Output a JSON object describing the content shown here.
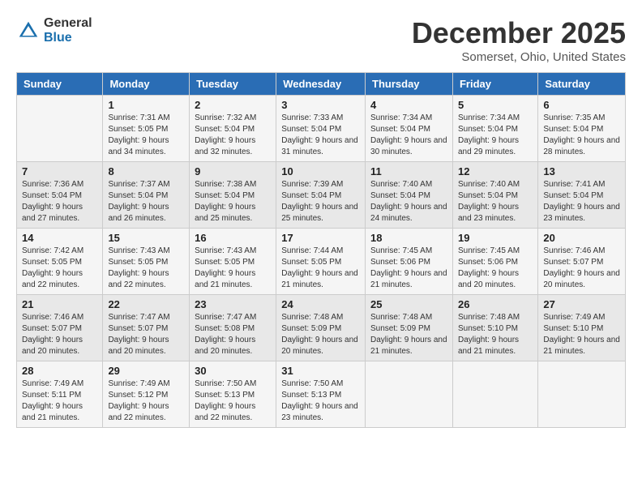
{
  "header": {
    "logo_general": "General",
    "logo_blue": "Blue",
    "month_title": "December 2025",
    "location": "Somerset, Ohio, United States"
  },
  "weekdays": [
    "Sunday",
    "Monday",
    "Tuesday",
    "Wednesday",
    "Thursday",
    "Friday",
    "Saturday"
  ],
  "weeks": [
    [
      {
        "day": "",
        "sunrise": "",
        "sunset": "",
        "daylight": ""
      },
      {
        "day": "1",
        "sunrise": "Sunrise: 7:31 AM",
        "sunset": "Sunset: 5:05 PM",
        "daylight": "Daylight: 9 hours and 34 minutes."
      },
      {
        "day": "2",
        "sunrise": "Sunrise: 7:32 AM",
        "sunset": "Sunset: 5:04 PM",
        "daylight": "Daylight: 9 hours and 32 minutes."
      },
      {
        "day": "3",
        "sunrise": "Sunrise: 7:33 AM",
        "sunset": "Sunset: 5:04 PM",
        "daylight": "Daylight: 9 hours and 31 minutes."
      },
      {
        "day": "4",
        "sunrise": "Sunrise: 7:34 AM",
        "sunset": "Sunset: 5:04 PM",
        "daylight": "Daylight: 9 hours and 30 minutes."
      },
      {
        "day": "5",
        "sunrise": "Sunrise: 7:34 AM",
        "sunset": "Sunset: 5:04 PM",
        "daylight": "Daylight: 9 hours and 29 minutes."
      },
      {
        "day": "6",
        "sunrise": "Sunrise: 7:35 AM",
        "sunset": "Sunset: 5:04 PM",
        "daylight": "Daylight: 9 hours and 28 minutes."
      }
    ],
    [
      {
        "day": "7",
        "sunrise": "Sunrise: 7:36 AM",
        "sunset": "Sunset: 5:04 PM",
        "daylight": "Daylight: 9 hours and 27 minutes."
      },
      {
        "day": "8",
        "sunrise": "Sunrise: 7:37 AM",
        "sunset": "Sunset: 5:04 PM",
        "daylight": "Daylight: 9 hours and 26 minutes."
      },
      {
        "day": "9",
        "sunrise": "Sunrise: 7:38 AM",
        "sunset": "Sunset: 5:04 PM",
        "daylight": "Daylight: 9 hours and 25 minutes."
      },
      {
        "day": "10",
        "sunrise": "Sunrise: 7:39 AM",
        "sunset": "Sunset: 5:04 PM",
        "daylight": "Daylight: 9 hours and 25 minutes."
      },
      {
        "day": "11",
        "sunrise": "Sunrise: 7:40 AM",
        "sunset": "Sunset: 5:04 PM",
        "daylight": "Daylight: 9 hours and 24 minutes."
      },
      {
        "day": "12",
        "sunrise": "Sunrise: 7:40 AM",
        "sunset": "Sunset: 5:04 PM",
        "daylight": "Daylight: 9 hours and 23 minutes."
      },
      {
        "day": "13",
        "sunrise": "Sunrise: 7:41 AM",
        "sunset": "Sunset: 5:04 PM",
        "daylight": "Daylight: 9 hours and 23 minutes."
      }
    ],
    [
      {
        "day": "14",
        "sunrise": "Sunrise: 7:42 AM",
        "sunset": "Sunset: 5:05 PM",
        "daylight": "Daylight: 9 hours and 22 minutes."
      },
      {
        "day": "15",
        "sunrise": "Sunrise: 7:43 AM",
        "sunset": "Sunset: 5:05 PM",
        "daylight": "Daylight: 9 hours and 22 minutes."
      },
      {
        "day": "16",
        "sunrise": "Sunrise: 7:43 AM",
        "sunset": "Sunset: 5:05 PM",
        "daylight": "Daylight: 9 hours and 21 minutes."
      },
      {
        "day": "17",
        "sunrise": "Sunrise: 7:44 AM",
        "sunset": "Sunset: 5:05 PM",
        "daylight": "Daylight: 9 hours and 21 minutes."
      },
      {
        "day": "18",
        "sunrise": "Sunrise: 7:45 AM",
        "sunset": "Sunset: 5:06 PM",
        "daylight": "Daylight: 9 hours and 21 minutes."
      },
      {
        "day": "19",
        "sunrise": "Sunrise: 7:45 AM",
        "sunset": "Sunset: 5:06 PM",
        "daylight": "Daylight: 9 hours and 20 minutes."
      },
      {
        "day": "20",
        "sunrise": "Sunrise: 7:46 AM",
        "sunset": "Sunset: 5:07 PM",
        "daylight": "Daylight: 9 hours and 20 minutes."
      }
    ],
    [
      {
        "day": "21",
        "sunrise": "Sunrise: 7:46 AM",
        "sunset": "Sunset: 5:07 PM",
        "daylight": "Daylight: 9 hours and 20 minutes."
      },
      {
        "day": "22",
        "sunrise": "Sunrise: 7:47 AM",
        "sunset": "Sunset: 5:07 PM",
        "daylight": "Daylight: 9 hours and 20 minutes."
      },
      {
        "day": "23",
        "sunrise": "Sunrise: 7:47 AM",
        "sunset": "Sunset: 5:08 PM",
        "daylight": "Daylight: 9 hours and 20 minutes."
      },
      {
        "day": "24",
        "sunrise": "Sunrise: 7:48 AM",
        "sunset": "Sunset: 5:09 PM",
        "daylight": "Daylight: 9 hours and 20 minutes."
      },
      {
        "day": "25",
        "sunrise": "Sunrise: 7:48 AM",
        "sunset": "Sunset: 5:09 PM",
        "daylight": "Daylight: 9 hours and 21 minutes."
      },
      {
        "day": "26",
        "sunrise": "Sunrise: 7:48 AM",
        "sunset": "Sunset: 5:10 PM",
        "daylight": "Daylight: 9 hours and 21 minutes."
      },
      {
        "day": "27",
        "sunrise": "Sunrise: 7:49 AM",
        "sunset": "Sunset: 5:10 PM",
        "daylight": "Daylight: 9 hours and 21 minutes."
      }
    ],
    [
      {
        "day": "28",
        "sunrise": "Sunrise: 7:49 AM",
        "sunset": "Sunset: 5:11 PM",
        "daylight": "Daylight: 9 hours and 21 minutes."
      },
      {
        "day": "29",
        "sunrise": "Sunrise: 7:49 AM",
        "sunset": "Sunset: 5:12 PM",
        "daylight": "Daylight: 9 hours and 22 minutes."
      },
      {
        "day": "30",
        "sunrise": "Sunrise: 7:50 AM",
        "sunset": "Sunset: 5:13 PM",
        "daylight": "Daylight: 9 hours and 22 minutes."
      },
      {
        "day": "31",
        "sunrise": "Sunrise: 7:50 AM",
        "sunset": "Sunset: 5:13 PM",
        "daylight": "Daylight: 9 hours and 23 minutes."
      },
      {
        "day": "",
        "sunrise": "",
        "sunset": "",
        "daylight": ""
      },
      {
        "day": "",
        "sunrise": "",
        "sunset": "",
        "daylight": ""
      },
      {
        "day": "",
        "sunrise": "",
        "sunset": "",
        "daylight": ""
      }
    ]
  ]
}
